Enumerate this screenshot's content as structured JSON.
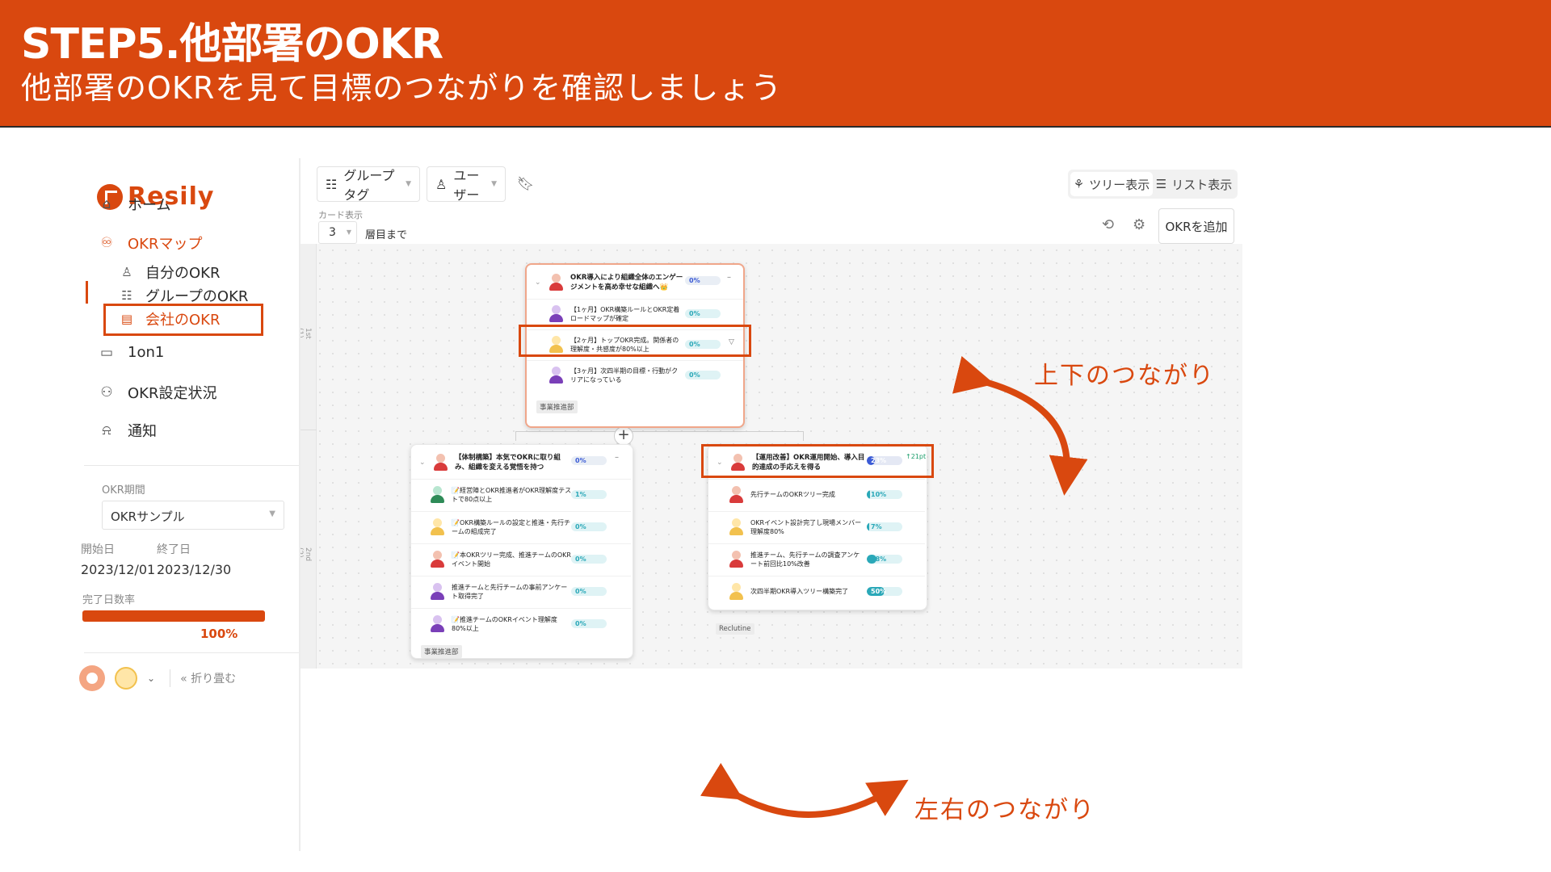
{
  "banner": {
    "title": "STEP5.他部署のOKR",
    "subtitle": "他部署のOKRを見て目標のつながりを確認しましょう"
  },
  "colors": {
    "accent": "#d9480f",
    "teal": "#2aa8b8",
    "blue": "#3b5bd6"
  },
  "sidebar": {
    "logo": "Resily",
    "nav": [
      {
        "label": "ホーム",
        "icon": "home-icon"
      },
      {
        "label": "OKRマップ",
        "icon": "okr-map-icon",
        "active": true
      },
      {
        "label": "1on1",
        "icon": "chat-icon"
      },
      {
        "label": "OKR設定状況",
        "icon": "users-icon"
      },
      {
        "label": "通知",
        "icon": "bell-icon"
      }
    ],
    "sub": [
      {
        "label": "自分のOKR",
        "icon": "user-icon"
      },
      {
        "label": "グループのOKR",
        "icon": "group-icon"
      },
      {
        "label": "会社のOKR",
        "icon": "building-icon",
        "active": true
      }
    ],
    "period_label": "OKR期間",
    "period_value": "OKRサンプル",
    "start_label": "開始日",
    "end_label": "終了日",
    "start_date": "2023/12/01",
    "end_date": "2023/12/30",
    "rate_label": "完了日数率",
    "rate_value": "100%",
    "rate_fraction": 1.0,
    "collapse_label": "折り畳む"
  },
  "toolbar": {
    "group_tag": "グループタグ",
    "user": "ユーザー",
    "tree_view": "ツリー表示",
    "list_view": "リスト表示",
    "card_display": "カード表示",
    "layer_value": "3",
    "layer_suffix": "層目まで",
    "add_okr": "OKRを追加"
  },
  "canvas": {
    "lane1": "1st (1)",
    "lane2": "2nd (2)"
  },
  "top_card": {
    "objective": "OKR導入により組織全体のエンゲージメントを高め幸せな組織へ👑",
    "objective_pct": "0%",
    "krs": [
      {
        "text": "【1ヶ月】OKR構築ルールとOKR定着ロードマップが確定",
        "pct": "0%"
      },
      {
        "text": "【2ヶ月】トップOKR完成。関係者の理解度・共感度が80%以上",
        "pct": "0%"
      },
      {
        "text": "【3ヶ月】次四半期の目標・行動がクリアになっている",
        "pct": "0%"
      }
    ],
    "tag": "事業推進部"
  },
  "left_card": {
    "objective": "【体制構築】本気でOKRに取り組み、組織を変える覚悟を持つ",
    "objective_pct": "0%",
    "krs": [
      {
        "text": "📝経営陣とOKR推進者がOKR理解度テストで80点以上",
        "pct": "1%"
      },
      {
        "text": "📝OKR構築ルールの設定と推進・先行チームの組成完了",
        "pct": "0%"
      },
      {
        "text": "📝本OKRツリー完成、推進チームのOKRイベント開始",
        "pct": "0%"
      },
      {
        "text": "推進チームと先行チームの事前アンケート取得完了",
        "pct": "0%"
      },
      {
        "text": "📝推進チームのOKRイベント理解度 80%以上",
        "pct": "0%"
      }
    ],
    "tag": "事業推進部"
  },
  "right_card": {
    "objective": "【運用改善】OKR運用開始、導入目的達成の手応えを得る",
    "objective_pct": "23%",
    "objective_pct_value": 23,
    "delta": "↑21pt",
    "krs": [
      {
        "text": "先行チームのOKRツリー完成",
        "pct": "10%",
        "value": 10
      },
      {
        "text": "OKRイベント設計完了し現場メンバー理解度80%",
        "pct": "7%",
        "value": 7
      },
      {
        "text": "推進チーム、先行チームの調査アンケート前回比10%改善",
        "pct": "28%",
        "value": 28
      },
      {
        "text": "次四半期OKR導入ツリー構築完了",
        "pct": "50%",
        "value": 50
      }
    ],
    "tag": "Reclutine"
  },
  "annotations": {
    "vertical": "上下のつながり",
    "horizontal": "左右のつながり"
  }
}
